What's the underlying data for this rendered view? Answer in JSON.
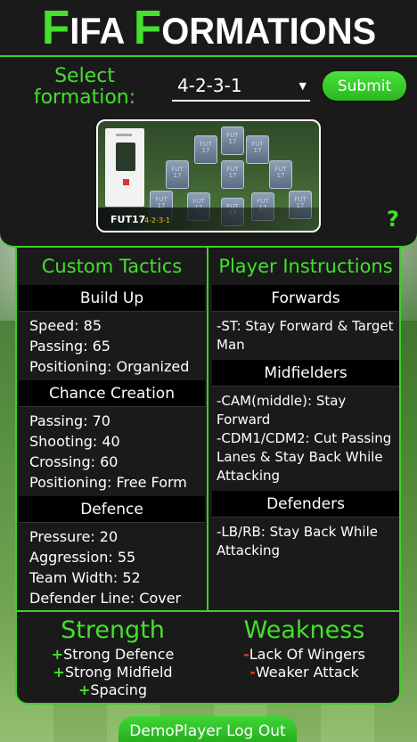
{
  "header": {
    "title_f1": "F",
    "title_rest1": "IFA ",
    "title_f2": "F",
    "title_rest2": "ORMATIONS"
  },
  "formation_select": {
    "label": "Select formation:",
    "value": "4-2-3-1"
  },
  "submit_label": "Submit",
  "preview": {
    "brand": "FUT17",
    "formation": "4-2-3-1",
    "card_text": "FUT 17"
  },
  "help_label": "?",
  "custom_tactics": {
    "heading": "Custom Tactics",
    "build_up": {
      "title": "Build Up",
      "stats": [
        "Speed: 85",
        "Passing: 65",
        "Positioning: Organized"
      ]
    },
    "chance_creation": {
      "title": "Chance Creation",
      "stats": [
        "Passing: 70",
        "Shooting: 40",
        "Crossing: 60",
        "Positioning: Free Form"
      ]
    },
    "defence": {
      "title": "Defence",
      "stats": [
        "Pressure: 20",
        "Aggression: 55",
        "Team Width: 52",
        "Defender Line: Cover"
      ]
    }
  },
  "player_instructions": {
    "heading": "Player Instructions",
    "forwards": {
      "title": "Forwards",
      "text": "-ST: Stay Forward & Target Man"
    },
    "midfielders": {
      "title": "Midfielders",
      "line1": "-CAM(middle): Stay Forward",
      "line2": "-CDM1/CDM2: Cut Passing Lanes & Stay Back While Attacking"
    },
    "defenders": {
      "title": "Defenders",
      "text": "-LB/RB: Stay Back While Attacking"
    }
  },
  "strength": {
    "title": "Strength",
    "items": [
      "Strong Defence",
      "Strong Midfield",
      "Spacing"
    ]
  },
  "weakness": {
    "title": "Weakness",
    "items": [
      "Lack Of Wingers",
      "Weaker Attack"
    ]
  },
  "logout_label": "DemoPlayer Log Out"
}
